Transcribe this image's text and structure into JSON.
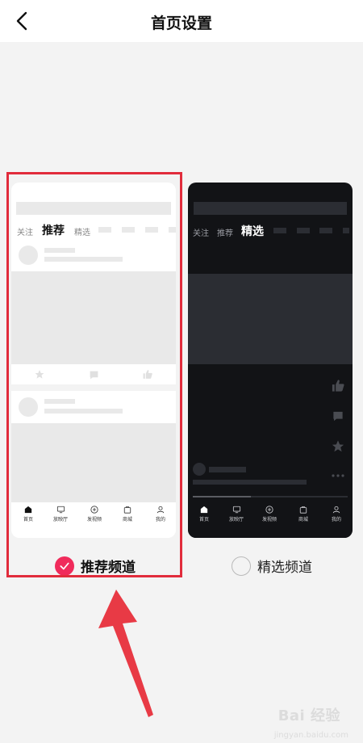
{
  "header": {
    "title": "首页设置"
  },
  "options": [
    {
      "id": "recommend",
      "label": "推荐频道",
      "selected": true,
      "preview": {
        "tabs": [
          "关注",
          "推荐",
          "精选"
        ],
        "nav": [
          "首页",
          "放映厅",
          "发视频",
          "商城",
          "我的"
        ]
      }
    },
    {
      "id": "featured",
      "label": "精选频道",
      "selected": false,
      "preview": {
        "tabs": [
          "关注",
          "推荐",
          "精选"
        ],
        "nav": [
          "首页",
          "放映厅",
          "发视频",
          "商城",
          "我的"
        ]
      }
    }
  ],
  "watermark": {
    "brand": "Bai 经验",
    "sub": "jingyan.baidu.com"
  },
  "colors": {
    "accent": "#f02b5b",
    "highlight": "#e12c3c",
    "dark_card": "#121316"
  }
}
